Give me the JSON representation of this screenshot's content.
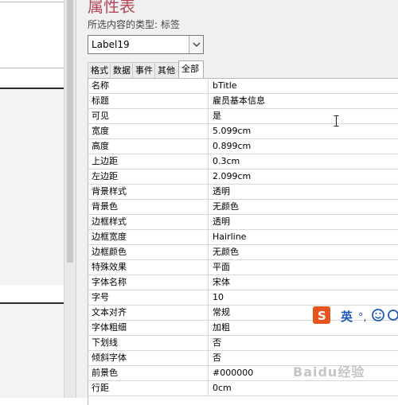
{
  "sheet": {
    "title": "属性表",
    "selection_label": "所选内容的类型: 标签",
    "combo_value": "Label19",
    "tabs": [
      {
        "label": "格式",
        "active": false
      },
      {
        "label": "数据",
        "active": false
      },
      {
        "label": "事件",
        "active": false
      },
      {
        "label": "其他",
        "active": false
      },
      {
        "label": "全部",
        "active": true
      }
    ],
    "properties": [
      {
        "name": "名称",
        "value": "bTitle"
      },
      {
        "name": "标题",
        "value": "雇员基本信息"
      },
      {
        "name": "可见",
        "value": "是"
      },
      {
        "name": "宽度",
        "value": "5.099cm"
      },
      {
        "name": "高度",
        "value": "0.899cm"
      },
      {
        "name": "上边距",
        "value": "0.3cm"
      },
      {
        "name": "左边距",
        "value": "2.099cm"
      },
      {
        "name": "背景样式",
        "value": "透明"
      },
      {
        "name": "背景色",
        "value": "无颜色"
      },
      {
        "name": "边框样式",
        "value": "透明"
      },
      {
        "name": "边框宽度",
        "value": "Hairline"
      },
      {
        "name": "边框颜色",
        "value": "无颜色"
      },
      {
        "name": "特殊效果",
        "value": "平面"
      },
      {
        "name": "字体名称",
        "value": "宋体"
      },
      {
        "name": "字号",
        "value": "10"
      },
      {
        "name": "文本对齐",
        "value": "常规"
      },
      {
        "name": "字体粗细",
        "value": "加粗"
      },
      {
        "name": "下划线",
        "value": "否"
      },
      {
        "name": "倾斜字体",
        "value": "否"
      },
      {
        "name": "前景色",
        "value": "#000000"
      },
      {
        "name": "行距",
        "value": "0cm"
      }
    ]
  },
  "ime": {
    "logo": "S",
    "mode_label": "英",
    "punct": "°,",
    "emoji_icon": "smiley-icon"
  },
  "watermark": "Baidu经验",
  "colors": {
    "title": "#b5495b",
    "ime_logo": "#e8541e",
    "ime_text": "#1e5bb8"
  }
}
